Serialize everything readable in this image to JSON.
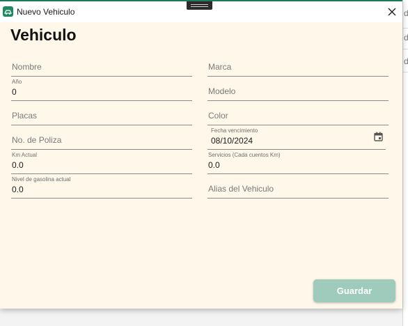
{
  "window": {
    "title": "Nuevo Vehiculo"
  },
  "heading": "Vehiculo",
  "background_app": {
    "fragments": [
      "da",
      "da",
      "da"
    ]
  },
  "fields": {
    "nombre": {
      "placeholder": "Nombre",
      "label": "",
      "value": ""
    },
    "marca": {
      "placeholder": "Marca",
      "label": "",
      "value": ""
    },
    "anio": {
      "placeholder": "",
      "label": "Año",
      "value": "0"
    },
    "modelo": {
      "placeholder": "Modelo",
      "label": "",
      "value": ""
    },
    "placas": {
      "placeholder": "Placas",
      "label": "",
      "value": ""
    },
    "color": {
      "placeholder": "Color",
      "label": "",
      "value": ""
    },
    "poliza": {
      "placeholder": "No. de Poliza",
      "label": "",
      "value": ""
    },
    "fecha_vencimiento": {
      "placeholder": "",
      "label": "Fecha vencimiento",
      "value": "08/10/2024"
    },
    "km_actual": {
      "placeholder": "",
      "label": "Km Actual",
      "value": "0.0"
    },
    "servicios": {
      "placeholder": "",
      "label": "Servicios (Cada cuentos Km)",
      "value": "0.0"
    },
    "nivel_gasolina": {
      "placeholder": "",
      "label": "Nivel de gasolina actual",
      "value": "0.0"
    },
    "alias": {
      "placeholder": "Alias del Vehiculo",
      "label": "",
      "value": ""
    }
  },
  "actions": {
    "save_label": "Guardar"
  },
  "colors": {
    "accent": "#1f7a5a",
    "button": "#9ecbbb",
    "form_bg": "#fff7ea"
  },
  "icons": {
    "app": "car-app-icon",
    "close": "close-icon",
    "calendar": "calendar-icon"
  }
}
